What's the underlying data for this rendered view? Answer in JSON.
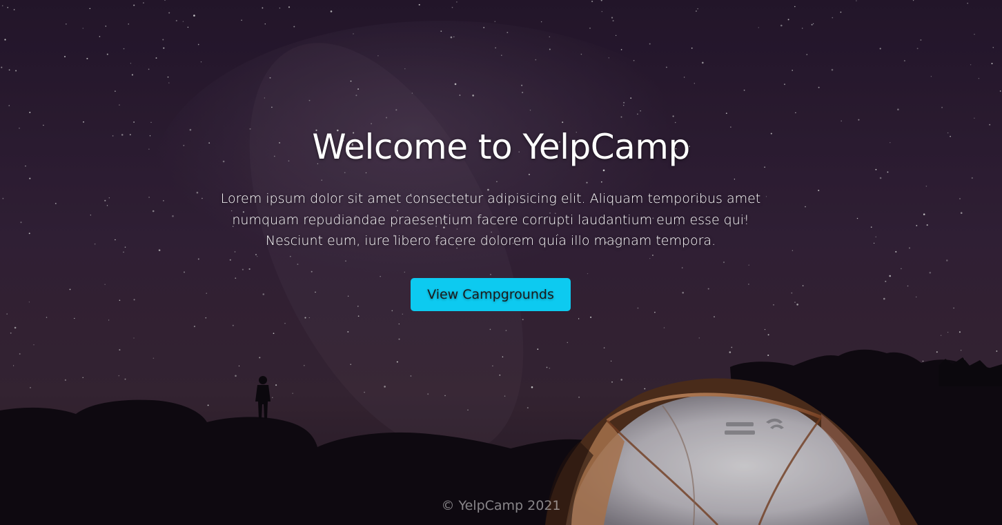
{
  "hero": {
    "title": "Welcome to YelpCamp",
    "description": "Lorem ipsum dolor sit amet consectetur adipisicing elit. Aliquam temporibus amet numquam repudiandae praesentium facere corrupti laudantium eum esse qui! Nesciunt eum, iure libero facere dolorem quia illo magnam tempora.",
    "button_label": "View Campgrounds"
  },
  "footer": {
    "copyright": "© YelpCamp 2021"
  },
  "colors": {
    "button_bg": "#0dcaf0",
    "text": "#ffffff",
    "sky_top": "#2a1a33",
    "sky_bottom": "#3e2a3e"
  }
}
